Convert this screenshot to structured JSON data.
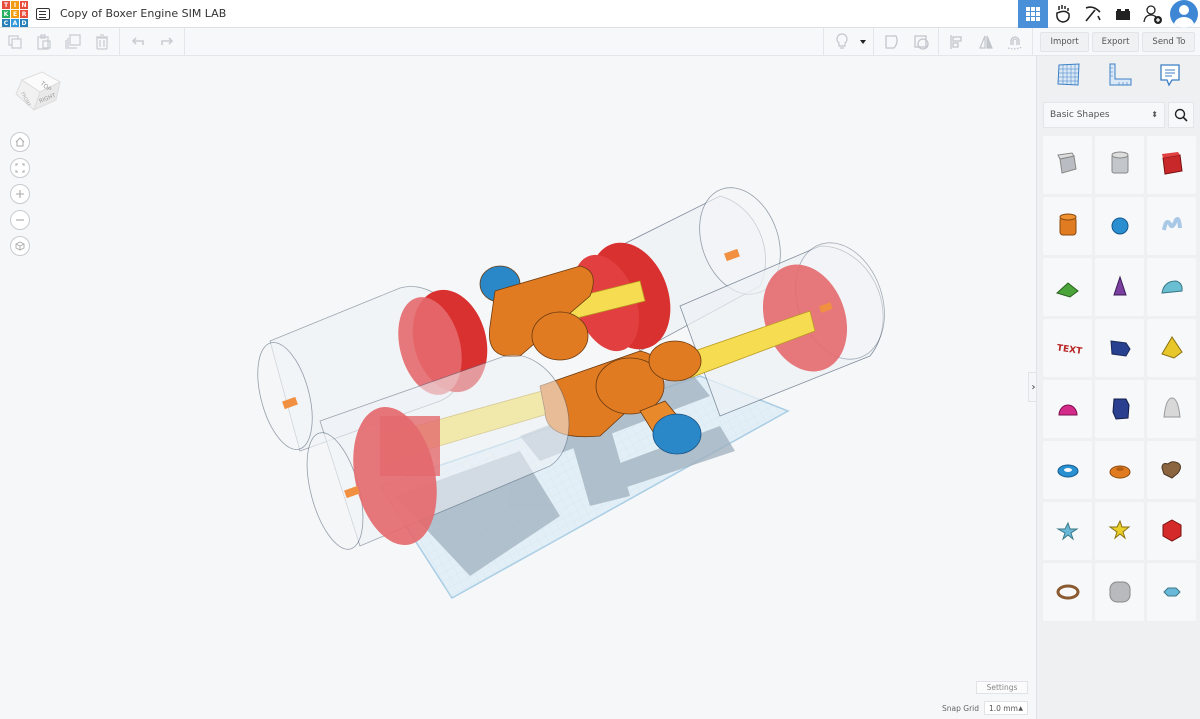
{
  "header": {
    "logo_letters": [
      "T",
      "I",
      "N",
      "K",
      "E",
      "R",
      "C",
      "A",
      "D"
    ],
    "doc_title": "Copy of Boxer Engine SIM LAB",
    "right_icons": [
      "3d-design-grid-icon",
      "codeblocks-hand-icon",
      "minecraft-pickaxe-icon",
      "lego-brick-icon",
      "add-user-icon",
      "user-avatar"
    ]
  },
  "toolbar": {
    "left_icons": [
      "copy-icon",
      "paste-icon",
      "duplicate-icon",
      "delete-icon",
      "undo-icon",
      "redo-icon"
    ],
    "right_icons": [
      "notes-bulb-icon",
      "dropdown-caret-icon",
      "group-icon",
      "ungroup-icon",
      "align-icon",
      "mirror-icon",
      "cruise-magnet-icon"
    ],
    "import_label": "Import",
    "export_label": "Export",
    "send_to_label": "Send To"
  },
  "viewcube": {
    "top": "TOP",
    "front": "FRONT",
    "right": "RIGHT"
  },
  "nav_controls": [
    "home-view-icon",
    "fit-all-icon",
    "zoom-in-icon",
    "zoom-out-icon",
    "perspective-icon"
  ],
  "canvas": {
    "settings_label": "Settings",
    "snap_grid_label": "Snap Grid",
    "snap_grid_value": "1.0 mm",
    "model_name": "Boxer Engine"
  },
  "panel": {
    "tabs": [
      "workplane-icon",
      "ruler-icon",
      "notes-icon"
    ],
    "category": "Basic Shapes",
    "shapes": [
      {
        "name": "Box Hole",
        "color": "#b9bcc2"
      },
      {
        "name": "Cylinder Hole",
        "color": "#c3c6cb"
      },
      {
        "name": "Box",
        "color": "#c8282a"
      },
      {
        "name": "Cylinder",
        "color": "#e07b22"
      },
      {
        "name": "Sphere",
        "color": "#2a8fd0"
      },
      {
        "name": "Scribble",
        "color": "#a9c8e6"
      },
      {
        "name": "Roof",
        "color": "#4aa43a"
      },
      {
        "name": "Cone",
        "color": "#7a3fa0"
      },
      {
        "name": "Round Roof",
        "color": "#69bfd1"
      },
      {
        "name": "Text",
        "color": "#b82424"
      },
      {
        "name": "Polygon",
        "color": "#27408f"
      },
      {
        "name": "Pyramid",
        "color": "#e8c72a"
      },
      {
        "name": "Half Sphere",
        "color": "#d42a8a"
      },
      {
        "name": "Polygon Prism",
        "color": "#2a3f8f"
      },
      {
        "name": "Paraboloid",
        "color": "#d8d8d8"
      },
      {
        "name": "Torus",
        "color": "#2a90d0"
      },
      {
        "name": "Tube",
        "color": "#e07b22"
      },
      {
        "name": "Heart",
        "color": "#8a6540"
      },
      {
        "name": "Star",
        "color": "#6ab8d8"
      },
      {
        "name": "Star Yellow",
        "color": "#e8cf2a"
      },
      {
        "name": "Icosahedron",
        "color": "#d42a2a"
      },
      {
        "name": "Ring",
        "color": "#8a5a30"
      },
      {
        "name": "Rounded Box",
        "color": "#b8babd"
      },
      {
        "name": "Gem",
        "color": "#6ab8d8"
      }
    ]
  },
  "colors": {
    "accent": "#4a90d9",
    "piston_red": "#d93030",
    "crank_orange": "#e07b22",
    "rod_yellow": "#f5dc50",
    "bearing_blue": "#2a88c8"
  }
}
